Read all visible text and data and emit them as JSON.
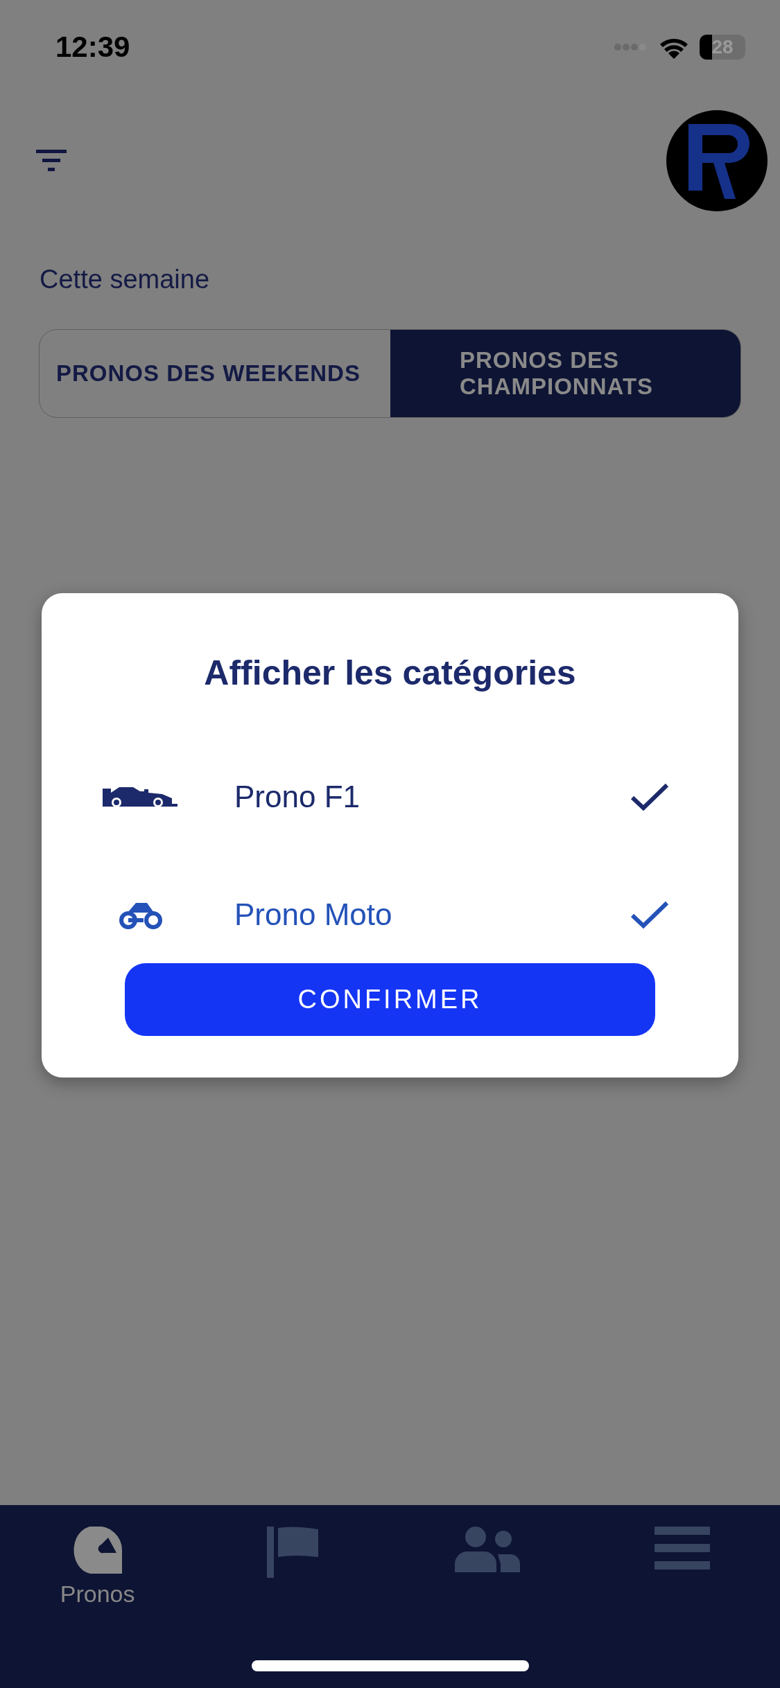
{
  "status_bar": {
    "time": "12:39",
    "battery": "28"
  },
  "header": {
    "subtitle": "Cette semaine"
  },
  "tabs": [
    {
      "label": "PRONOS DES WEEKENDS",
      "selected": false
    },
    {
      "label": "PRONOS DES CHAMPIONNATS",
      "selected": true
    }
  ],
  "dialog": {
    "title": "Afficher les catégories",
    "categories": [
      {
        "kind": "car",
        "label": "Prono F1",
        "checked": true,
        "color": "#1c2a6b"
      },
      {
        "kind": "moto",
        "label": "Prono Moto",
        "checked": true,
        "color": "#2452b8"
      }
    ],
    "confirm_button": "CONFIRMER"
  },
  "bottom_nav": [
    {
      "kind": "helmet",
      "label": "Pronos",
      "selected": true
    },
    {
      "kind": "flag",
      "selected": false
    },
    {
      "kind": "people",
      "selected": false
    },
    {
      "kind": "menu",
      "selected": false
    }
  ]
}
